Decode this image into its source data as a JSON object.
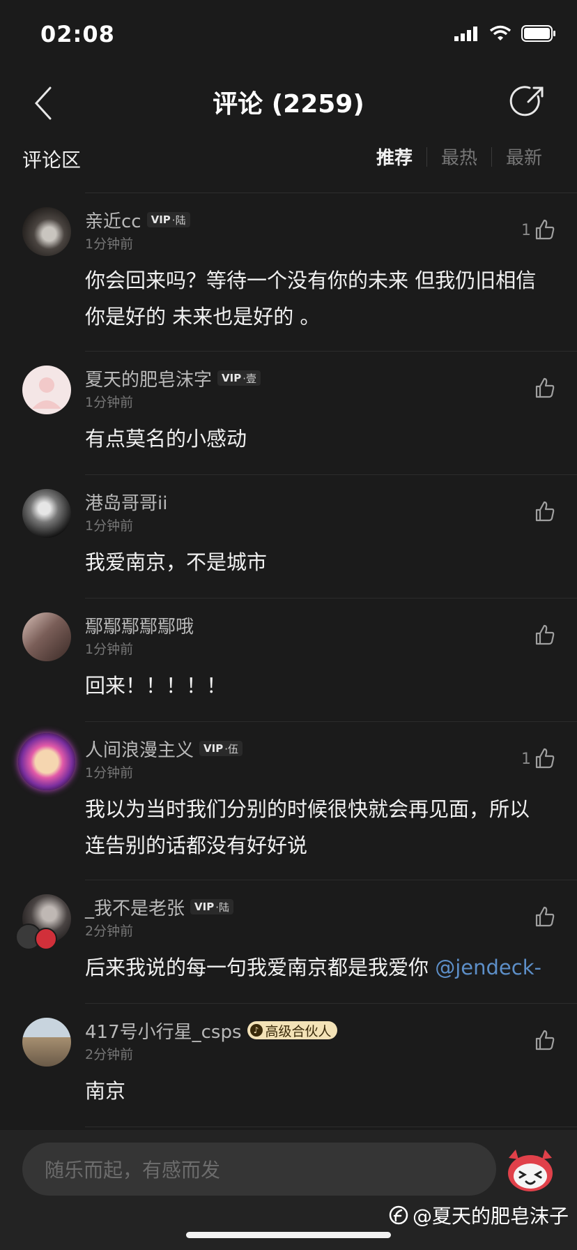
{
  "status": {
    "time": "02:08"
  },
  "nav": {
    "title": "评论 (2259)"
  },
  "section": {
    "title": "评论区",
    "tabs": [
      "推荐",
      "最热",
      "最新"
    ]
  },
  "comments": [
    {
      "user": "亲近cc",
      "vip": "VIP",
      "vip_level": "陆",
      "time": "1分钟前",
      "text": "你会回来吗？等待一个没有你的未来 但我仍旧相信 你是好的 未来也是好的 。",
      "likes": "1"
    },
    {
      "user": "夏天的肥皂沫字",
      "vip": "VIP",
      "vip_level": "壹",
      "time": "1分钟前",
      "text": "有点莫名的小感动",
      "likes": ""
    },
    {
      "user": "港岛哥哥ii",
      "time": "1分钟前",
      "text": "我爱南京，不是城市",
      "likes": ""
    },
    {
      "user": "鄢鄢鄢鄢鄢哦",
      "time": "1分钟前",
      "text": "回来！！！！！",
      "likes": ""
    },
    {
      "user": "人间浪漫主义",
      "vip": "VIP",
      "vip_level": "伍",
      "time": "1分钟前",
      "text": "我以为当时我们分别的时候很快就会再见面，所以连告别的话都没有好好说",
      "likes": "1"
    },
    {
      "user": "_我不是老张",
      "vip": "VIP",
      "vip_level": "陆",
      "time": "2分钟前",
      "text": "后来我说的每一句我爱南京都是我爱你 ",
      "mention": "@jendeck-",
      "likes": ""
    },
    {
      "user": "417号小行星_csps",
      "badge": "高级合伙人",
      "time": "2分钟前",
      "text": "南京",
      "likes": ""
    }
  ],
  "input": {
    "placeholder": "随乐而起，有感而发"
  },
  "watermark": "@夏天的肥皂沫子",
  "colors": {
    "background": "#1b1b1b",
    "mention": "#5d8fc8",
    "partner_badge": "#f3e2b7"
  }
}
